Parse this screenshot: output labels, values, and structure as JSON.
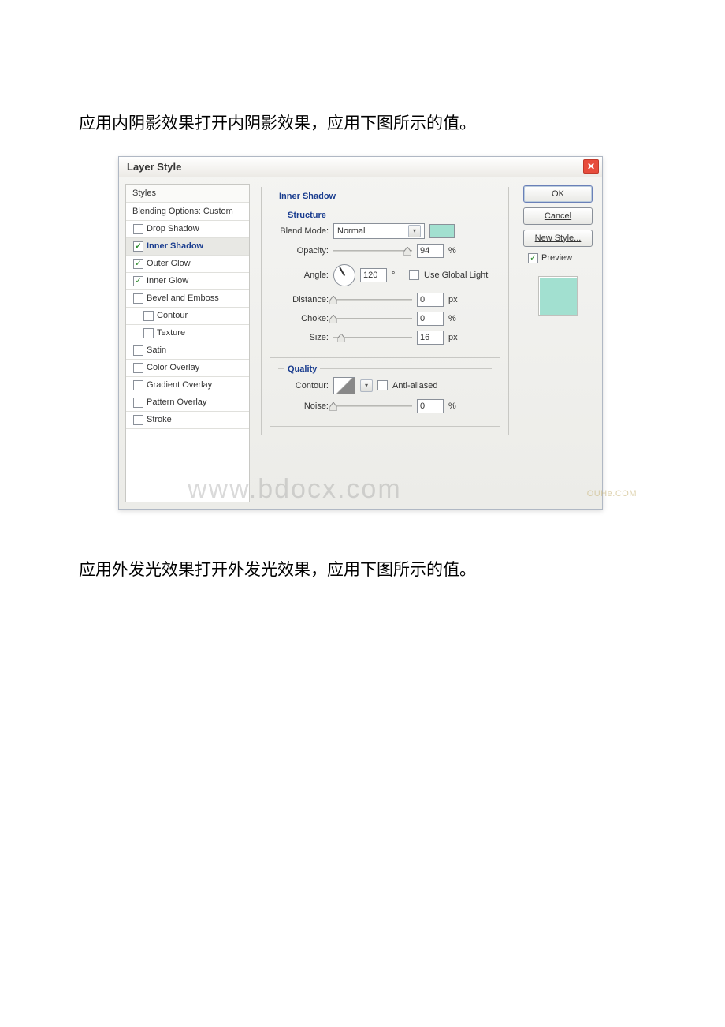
{
  "intro_text": "应用内阴影效果打开内阴影效果，应用下图所示的值。",
  "outro_text": "应用外发光效果打开外发光效果，应用下图所示的值。",
  "watermark_main": "www.bdocx.com",
  "watermark_secondary": "OUHe.COM",
  "dialog": {
    "title": "Layer Style",
    "effects": {
      "styles_header": "Styles",
      "blending_label": "Blending Options: Custom",
      "items": [
        {
          "label": "Drop Shadow",
          "checked": false,
          "selected": false,
          "indent": 1
        },
        {
          "label": "Inner Shadow",
          "checked": true,
          "selected": true,
          "indent": 1
        },
        {
          "label": "Outer Glow",
          "checked": true,
          "selected": false,
          "indent": 1
        },
        {
          "label": "Inner Glow",
          "checked": true,
          "selected": false,
          "indent": 1
        },
        {
          "label": "Bevel and Emboss",
          "checked": false,
          "selected": false,
          "indent": 1
        },
        {
          "label": "Contour",
          "checked": false,
          "selected": false,
          "indent": 2
        },
        {
          "label": "Texture",
          "checked": false,
          "selected": false,
          "indent": 2
        },
        {
          "label": "Satin",
          "checked": false,
          "selected": false,
          "indent": 1
        },
        {
          "label": "Color Overlay",
          "checked": false,
          "selected": false,
          "indent": 1
        },
        {
          "label": "Gradient Overlay",
          "checked": false,
          "selected": false,
          "indent": 1
        },
        {
          "label": "Pattern Overlay",
          "checked": false,
          "selected": false,
          "indent": 1
        },
        {
          "label": "Stroke",
          "checked": false,
          "selected": false,
          "indent": 1
        }
      ]
    },
    "panel": {
      "title": "Inner Shadow",
      "structure": {
        "title": "Structure",
        "blend_mode_label": "Blend Mode:",
        "blend_mode_value": "Normal",
        "color_swatch": "#a2e0d0",
        "opacity_label": "Opacity:",
        "opacity_value": "94",
        "opacity_unit": "%",
        "angle_label": "Angle:",
        "angle_value": "120",
        "angle_unit": "°",
        "global_light_label": "Use Global Light",
        "global_light_checked": false,
        "distance_label": "Distance:",
        "distance_value": "0",
        "distance_unit": "px",
        "choke_label": "Choke:",
        "choke_value": "0",
        "choke_unit": "%",
        "size_label": "Size:",
        "size_value": "16",
        "size_unit": "px"
      },
      "quality": {
        "title": "Quality",
        "contour_label": "Contour:",
        "antialiased_label": "Anti-aliased",
        "antialiased_checked": false,
        "noise_label": "Noise:",
        "noise_value": "0",
        "noise_unit": "%"
      }
    },
    "buttons": {
      "ok": "OK",
      "cancel": "Cancel",
      "new_style": "New Style...",
      "preview_label": "Preview",
      "preview_checked": true,
      "preview_swatch": "#a2e0d0"
    }
  }
}
